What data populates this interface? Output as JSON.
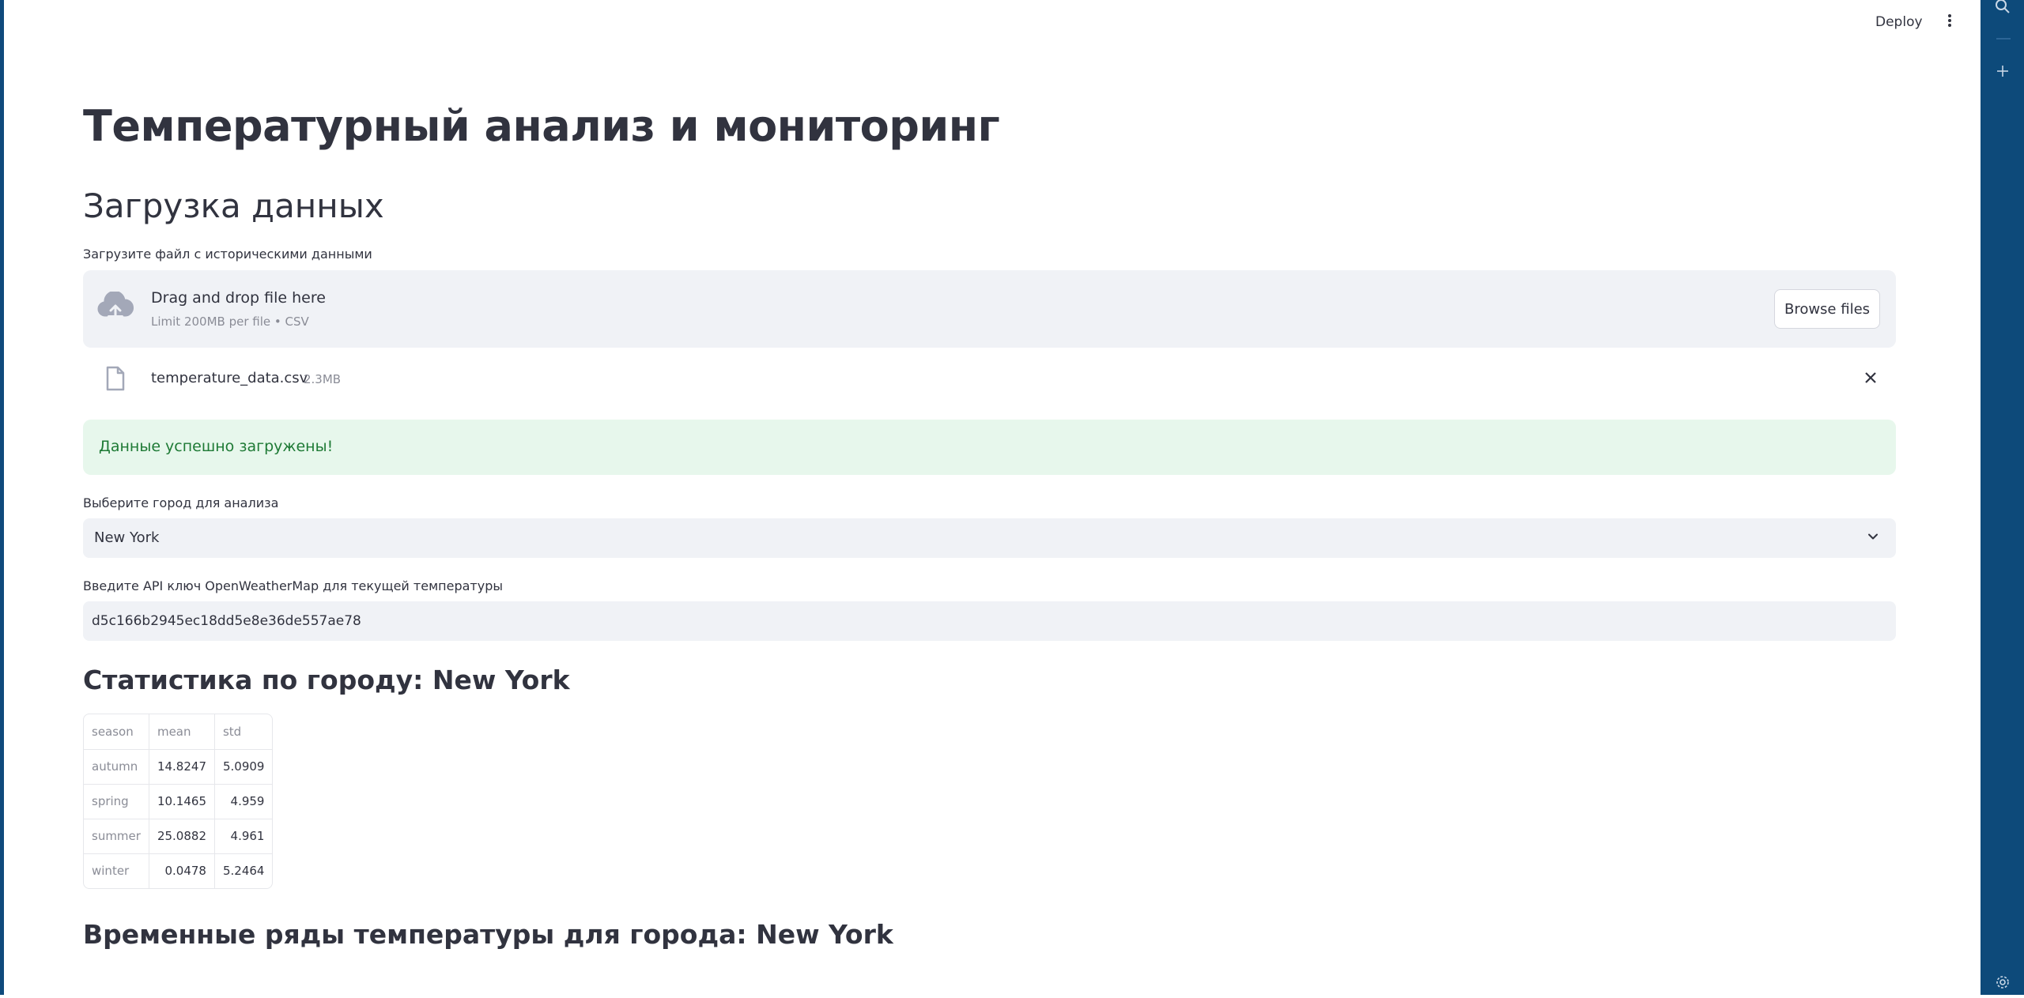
{
  "header": {
    "deploy_label": "Deploy",
    "menu_icon": "vertical-dots-icon"
  },
  "right_rail": {
    "icons": [
      "search-icon",
      "plus-icon",
      "gear-icon"
    ]
  },
  "page": {
    "title": "Температурный анализ и мониторинг",
    "upload_section_title": "Загрузка данных"
  },
  "uploader": {
    "label": "Загрузите файл с историческими данными",
    "drop_title": "Drag and drop file here",
    "drop_subtitle": "Limit 200MB per file • CSV",
    "browse_label": "Browse files",
    "icon": "cloud-upload-icon"
  },
  "uploaded_file": {
    "name": "temperature_data.csv",
    "size": "2.3MB",
    "icon": "file-icon"
  },
  "alert": {
    "text": "Данные успешно загружены!",
    "color": "#1e7a35",
    "background": "#e7f7ec"
  },
  "city_select": {
    "label": "Выберите город для анализа",
    "value": "New York"
  },
  "api_key": {
    "label": "Введите API ключ OpenWeatherMap для текущей температуры",
    "value": "d5c166b2945ec18dd5e8e36de557ae78"
  },
  "stats": {
    "title": "Статистика по городу: New York",
    "columns": [
      "season",
      "mean",
      "std"
    ],
    "rows": [
      [
        "autumn",
        "14.8247",
        "5.0909"
      ],
      [
        "spring",
        "10.1465",
        "4.959"
      ],
      [
        "summer",
        "25.0882",
        "4.961"
      ],
      [
        "winter",
        "0.0478",
        "5.2464"
      ]
    ]
  },
  "timeseries": {
    "title": "Временные ряды температуры для города: New York"
  },
  "colors": {
    "text": "#31333f",
    "muted": "#8a8c96",
    "input_bg": "#f0f2f6",
    "sidebar_rail": "#0d4a7a"
  }
}
